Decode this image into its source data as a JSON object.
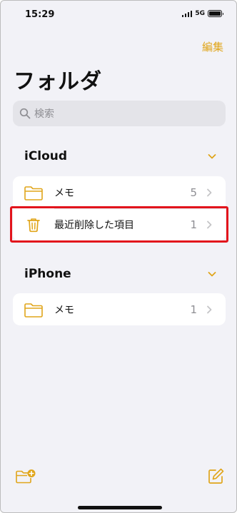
{
  "status": {
    "time": "15:29",
    "network": "5G"
  },
  "toolbar": {
    "edit_label": "編集"
  },
  "page": {
    "title": "フォルダ"
  },
  "search": {
    "placeholder": "検索"
  },
  "sections": [
    {
      "title": "iCloud",
      "items": [
        {
          "label": "メモ",
          "count": "5",
          "icon": "folder-icon"
        },
        {
          "label": "最近削除した項目",
          "count": "1",
          "icon": "trash-icon"
        }
      ]
    },
    {
      "title": "iPhone",
      "items": [
        {
          "label": "メモ",
          "count": "1",
          "icon": "folder-icon"
        }
      ]
    }
  ],
  "colors": {
    "accent": "#e0a51a",
    "highlight": "#e2141c",
    "background": "#f2f2f7"
  }
}
